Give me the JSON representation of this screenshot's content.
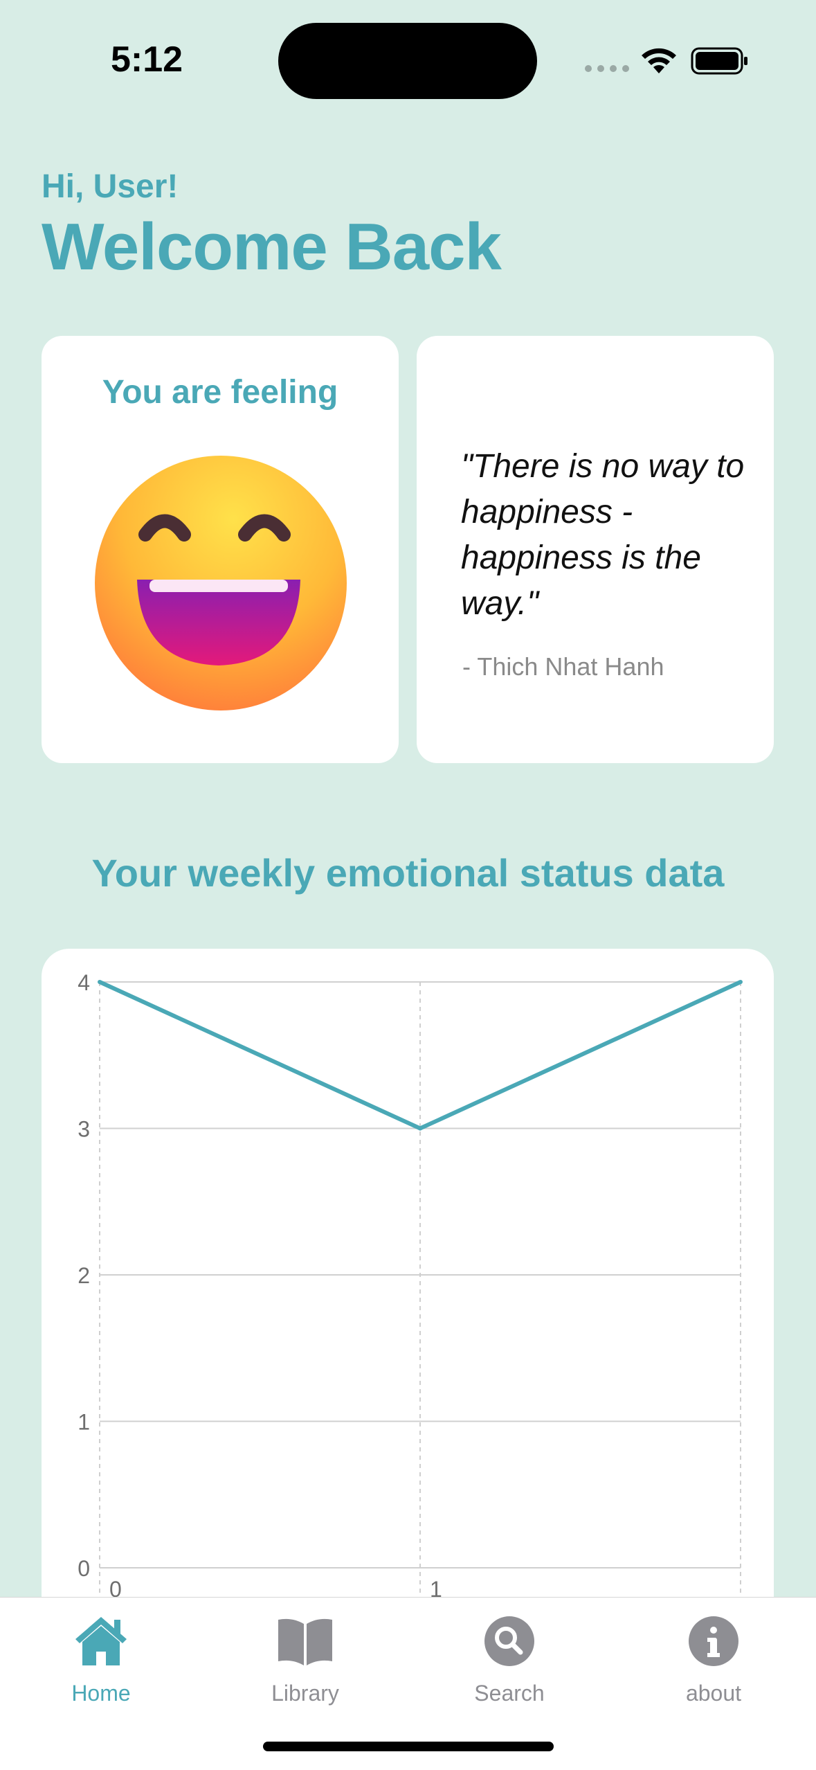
{
  "status_bar": {
    "time": "5:12"
  },
  "header": {
    "greeting": "Hi, User!",
    "title": "Welcome Back"
  },
  "feeling_card": {
    "title": "You are feeling",
    "emoji_icon": "grinning-face-with-smiling-eyes-icon"
  },
  "quote_card": {
    "text": "\"There is no way to happiness - happiness is the way.\"",
    "author": "- Thich Nhat Hanh"
  },
  "weekly": {
    "title": "Your weekly emotional status data"
  },
  "chart_data": {
    "type": "line",
    "x": [
      0,
      1,
      2
    ],
    "x_tick_labels": [
      "0",
      "1"
    ],
    "y_tick_labels": [
      "0",
      "1",
      "2",
      "3",
      "4"
    ],
    "series": [
      {
        "values": [
          4,
          3,
          4
        ]
      }
    ],
    "ylim": [
      0,
      4
    ],
    "grid": true,
    "color": "#4aa8b6"
  },
  "tabbar": {
    "tabs": [
      {
        "label": "Home",
        "icon": "house-icon",
        "active": true
      },
      {
        "label": "Library",
        "icon": "book-icon",
        "active": false
      },
      {
        "label": "Search",
        "icon": "search-icon",
        "active": false
      },
      {
        "label": "about",
        "icon": "info-icon",
        "active": false
      }
    ]
  },
  "colors": {
    "accent": "#4aa8b6",
    "background": "#d8ede6",
    "inactive": "#8e8e93"
  }
}
